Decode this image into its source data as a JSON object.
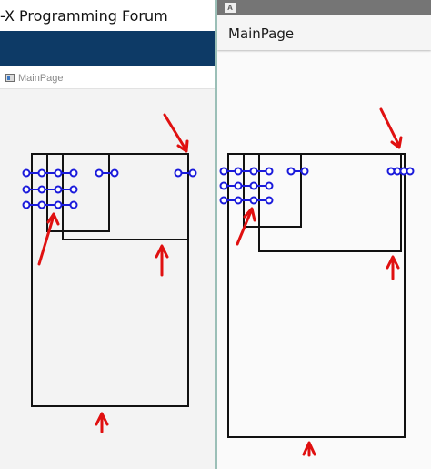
{
  "left_window": {
    "title": "-X Programming Forum",
    "tab_icon": "window-icon",
    "tab_label": "MainPage"
  },
  "right_window": {
    "status_icon": "A",
    "app_title": "MainPage"
  },
  "colors": {
    "banner": "#0d3a66",
    "status_bar": "#757575",
    "handles": "#1a1adb",
    "arrows": "#e01010"
  }
}
